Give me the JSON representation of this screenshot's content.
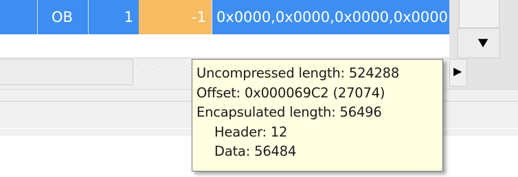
{
  "row": {
    "col_type": "OB",
    "col_count": "1",
    "col_value": "-1",
    "col_data": "0x0000,0x0000,0x0000,0x0000"
  },
  "scrollbar": {
    "down_glyph": "▼",
    "right_glyph": "▶"
  },
  "tooltip": {
    "uncompressed": "Uncompressed length: 524288",
    "offset": "Offset: 0x000069C2 (27074)",
    "encapsulated": "Encapsulated length: 56496",
    "header": "Header: 12",
    "data": "Data: 56484"
  },
  "colors": {
    "selection": "#3d8ef0",
    "highlight": "#f7bc62",
    "tooltip_bg": "#ffffe1"
  }
}
